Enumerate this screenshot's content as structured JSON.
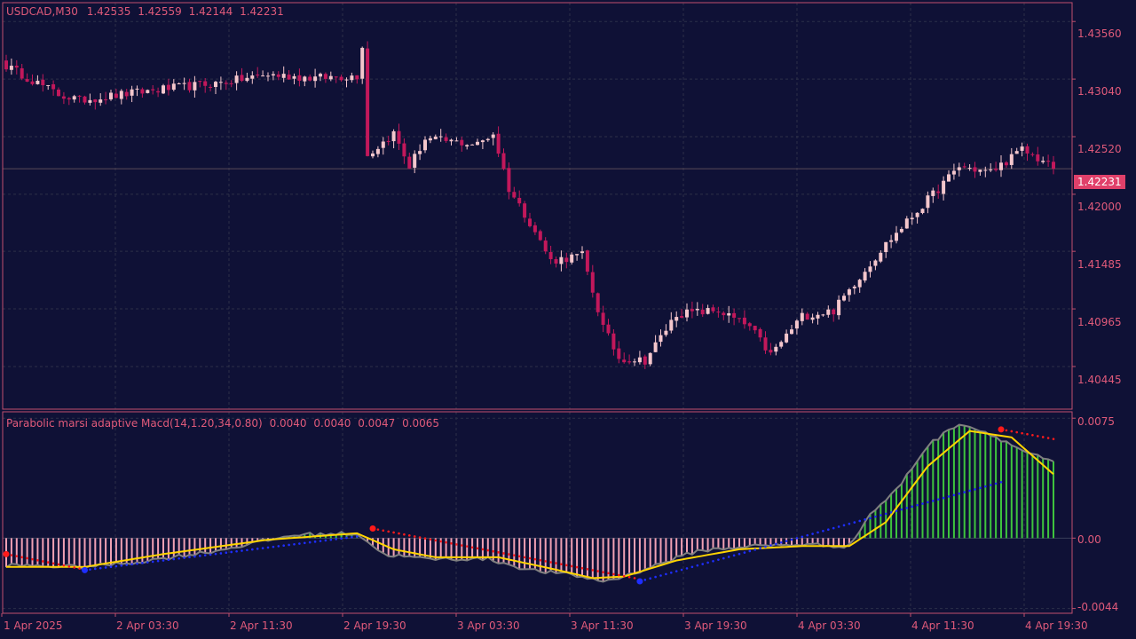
{
  "main": {
    "title": "USDCAD,M30",
    "ohlc": [
      "1.42535",
      "1.42559",
      "1.42144",
      "1.42231"
    ],
    "current_price": "1.42231"
  },
  "indicator": {
    "title": "Parabolic marsi adaptive Macd(14,1.20,34,0.80)",
    "values": [
      "0.0040",
      "0.0040",
      "0.0047",
      "0.0065"
    ]
  },
  "colors": {
    "background": "#0f1136",
    "frame": "#c0506e",
    "grid": "#2c3048",
    "label": "#e05a7a",
    "bull_candle": "#f4c6cc",
    "bear_candle": "#c2185b",
    "histogram_positive": "#3ec43e",
    "histogram_negative": "#f0a0b4",
    "macd_line": "#808080",
    "signal_line": "#ffd400",
    "sar_up": "#1e2eff",
    "sar_down": "#ff1a1a"
  },
  "chart_data": {
    "type": "candlestick",
    "symbol": "USDCAD",
    "timeframe": "M30",
    "x_tick_labels": [
      "1 Apr 2025",
      "2 Apr 03:30",
      "2 Apr 11:30",
      "2 Apr 19:30",
      "3 Apr 03:30",
      "3 Apr 11:30",
      "3 Apr 19:30",
      "4 Apr 03:30",
      "4 Apr 11:30",
      "4 Apr 19:30"
    ],
    "price_axis": {
      "ticks": [
        "1.43560",
        "1.43040",
        "1.42520",
        "1.42000",
        "1.41485",
        "1.40965",
        "1.40445"
      ],
      "range": [
        1.4006,
        1.4373
      ]
    },
    "indicator_axis": {
      "ticks": [
        "0.0075",
        "0.00",
        "-0.0044"
      ],
      "range": [
        -0.0047,
        0.0079
      ]
    },
    "price_key_points": [
      [
        0,
        1.4316
      ],
      [
        10,
        1.429
      ],
      [
        14,
        1.4285
      ],
      [
        30,
        1.4295
      ],
      [
        40,
        1.43
      ],
      [
        50,
        1.4308
      ],
      [
        59,
        1.4305
      ],
      [
        67,
        1.4307
      ],
      [
        68,
        1.4335
      ],
      [
        69,
        1.4235
      ],
      [
        74,
        1.4255
      ],
      [
        77,
        1.4225
      ],
      [
        80,
        1.425
      ],
      [
        90,
        1.4245
      ],
      [
        93,
        1.4255
      ],
      [
        96,
        1.4205
      ],
      [
        100,
        1.4175
      ],
      [
        104,
        1.414
      ],
      [
        110,
        1.4145
      ],
      [
        114,
        1.408
      ],
      [
        117,
        1.4052
      ],
      [
        122,
        1.405
      ],
      [
        128,
        1.4092
      ],
      [
        136,
        1.4095
      ],
      [
        142,
        1.408
      ],
      [
        146,
        1.4055
      ],
      [
        152,
        1.409
      ],
      [
        158,
        1.4095
      ],
      [
        162,
        1.412
      ],
      [
        168,
        1.4155
      ],
      [
        172,
        1.4175
      ],
      [
        176,
        1.4195
      ],
      [
        182,
        1.4225
      ],
      [
        188,
        1.422
      ],
      [
        194,
        1.424
      ],
      [
        198,
        1.423
      ],
      [
        200,
        1.4223
      ]
    ],
    "macd_key_points": [
      [
        0,
        -0.0017
      ],
      [
        15,
        -0.0018
      ],
      [
        25,
        -0.0015
      ],
      [
        40,
        -0.0008
      ],
      [
        55,
        0.0002
      ],
      [
        67,
        0.0003
      ],
      [
        72,
        -0.001
      ],
      [
        80,
        -0.0013
      ],
      [
        92,
        -0.0013
      ],
      [
        100,
        -0.002
      ],
      [
        108,
        -0.0023
      ],
      [
        114,
        -0.0027
      ],
      [
        118,
        -0.0024
      ],
      [
        124,
        -0.0017
      ],
      [
        132,
        -0.0008
      ],
      [
        142,
        -0.0005
      ],
      [
        152,
        -0.0004
      ],
      [
        161,
        -0.0005
      ],
      [
        165,
        0.0015
      ],
      [
        170,
        0.003
      ],
      [
        176,
        0.0058
      ],
      [
        182,
        0.0072
      ],
      [
        188,
        0.0065
      ],
      [
        194,
        0.0055
      ],
      [
        200,
        0.0047
      ]
    ],
    "signal_key_points": [
      [
        0,
        -0.0018
      ],
      [
        15,
        -0.0018
      ],
      [
        30,
        -0.001
      ],
      [
        50,
        -0.0001
      ],
      [
        67,
        0.0003
      ],
      [
        74,
        -0.0007
      ],
      [
        82,
        -0.0012
      ],
      [
        94,
        -0.0012
      ],
      [
        104,
        -0.0019
      ],
      [
        112,
        -0.0025
      ],
      [
        118,
        -0.0024
      ],
      [
        128,
        -0.0014
      ],
      [
        140,
        -0.0007
      ],
      [
        152,
        -0.0005
      ],
      [
        161,
        -0.0005
      ],
      [
        168,
        0.001
      ],
      [
        176,
        0.0045
      ],
      [
        184,
        0.0067
      ],
      [
        192,
        0.0063
      ],
      [
        200,
        0.004
      ]
    ],
    "sar_up_segments": [
      [
        [
          15,
          -0.002
        ],
        [
          67,
          0.0001
        ]
      ],
      [
        [
          121,
          -0.0027
        ],
        [
          190,
          0.0035
        ]
      ]
    ],
    "sar_down_segments": [
      [
        [
          0,
          -0.001
        ],
        [
          14,
          -0.0019
        ]
      ],
      [
        [
          70,
          0.0006
        ],
        [
          120,
          -0.0025
        ]
      ],
      [
        [
          190,
          0.0068
        ],
        [
          200,
          0.0062
        ]
      ]
    ]
  }
}
